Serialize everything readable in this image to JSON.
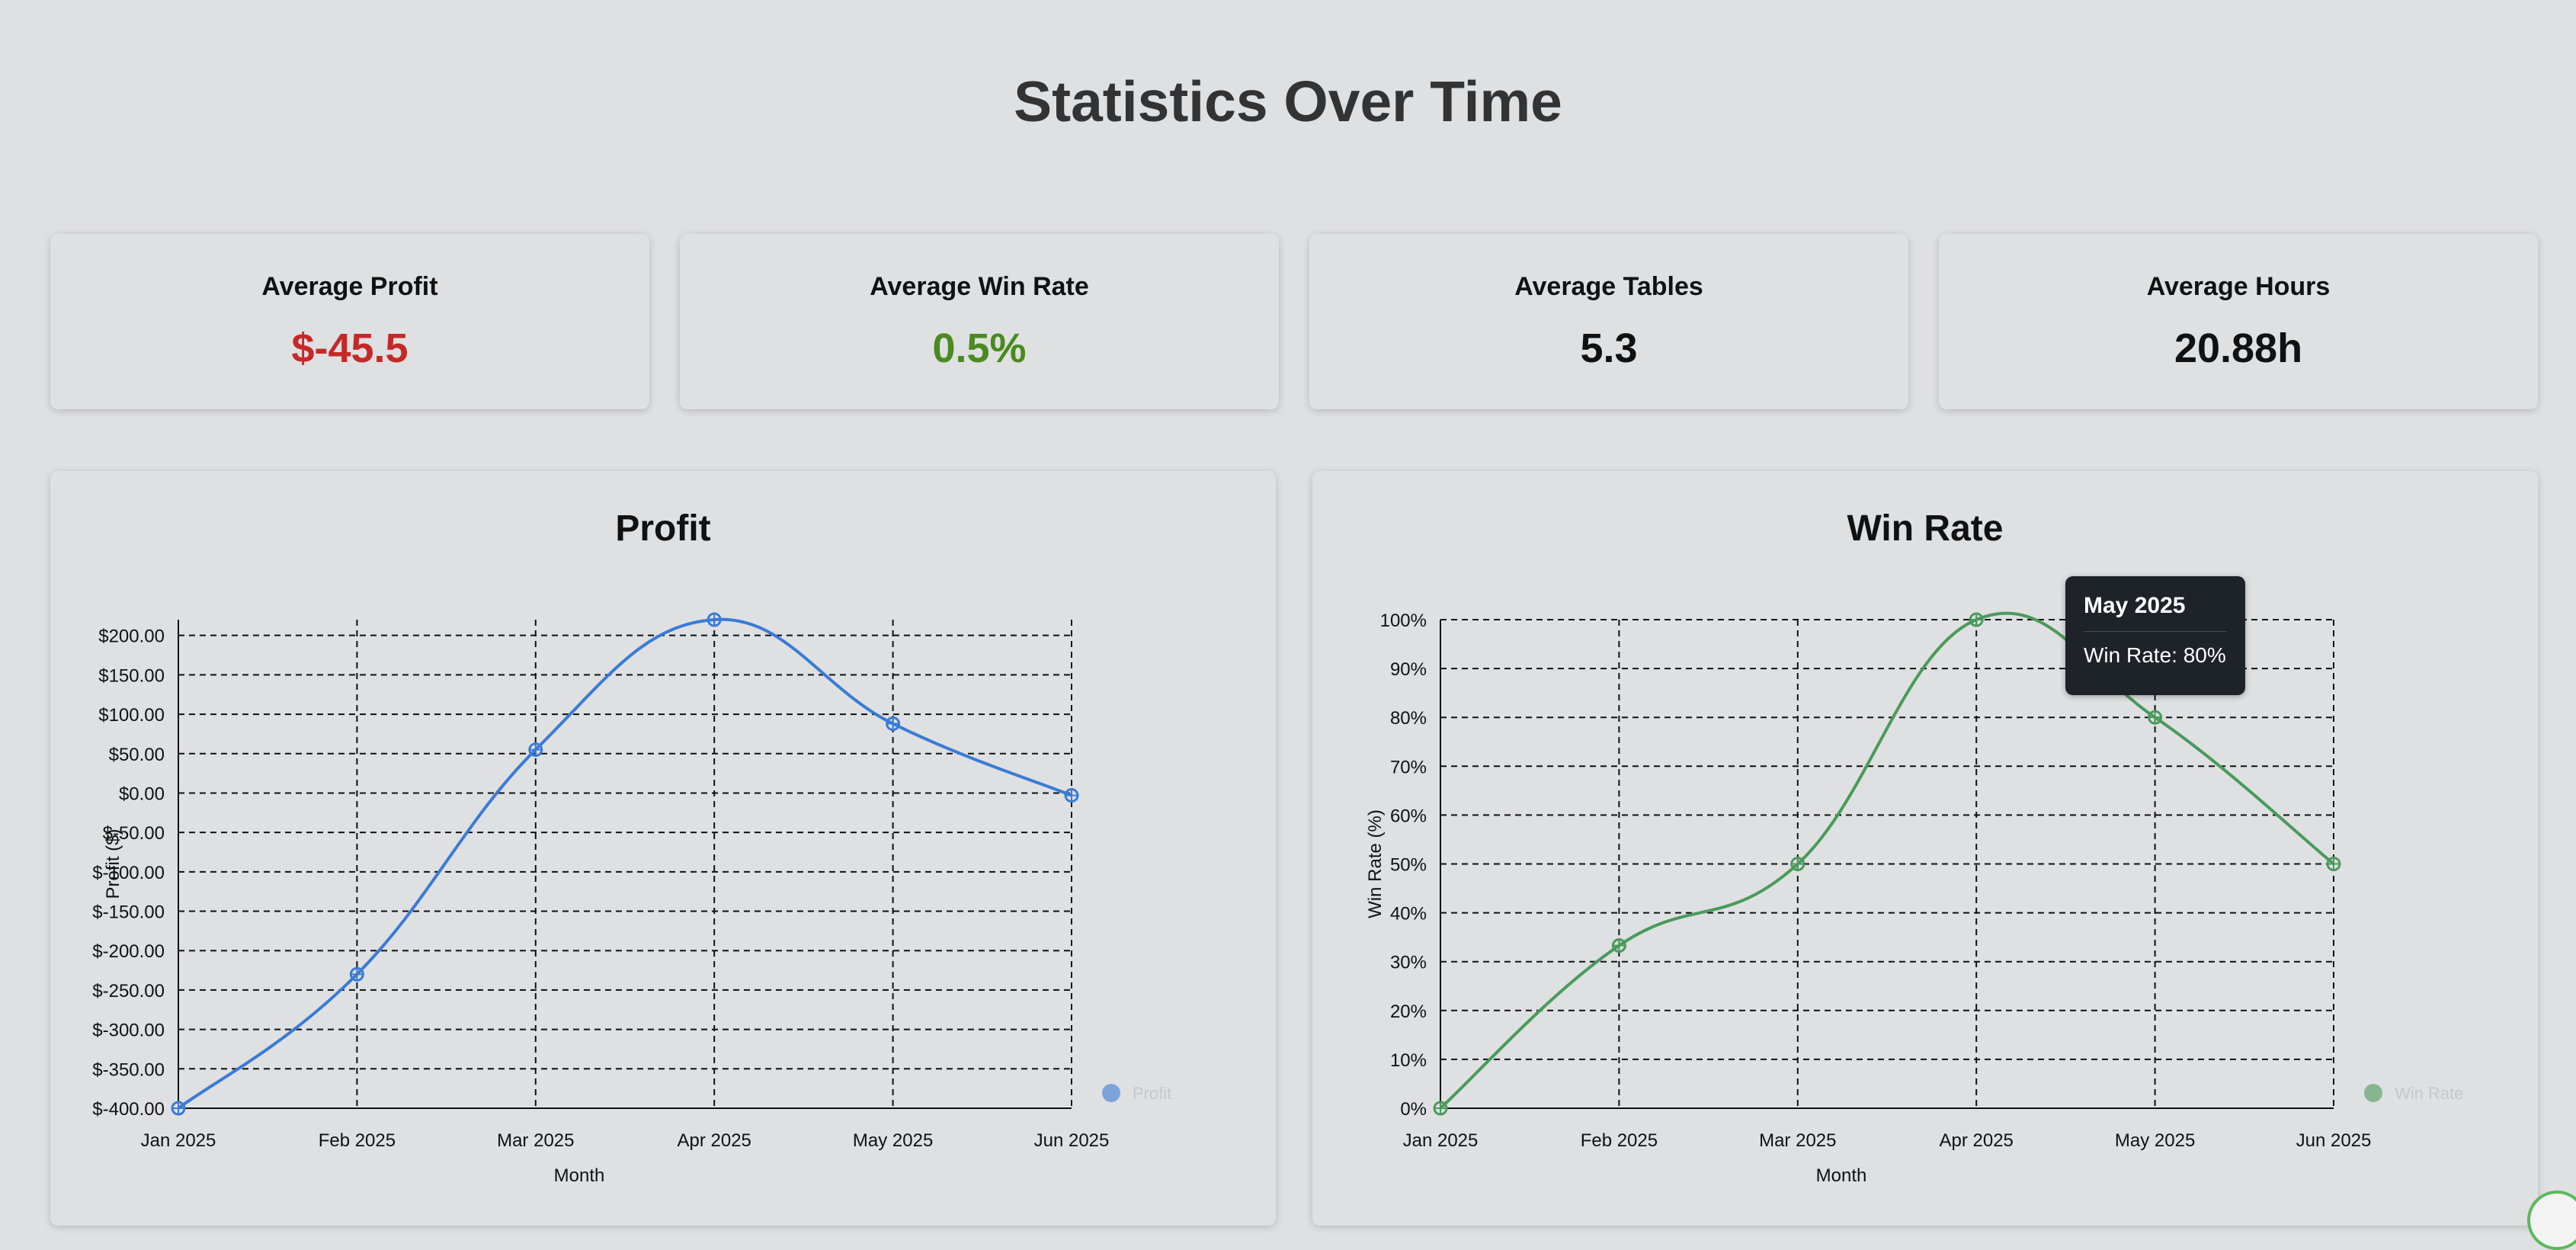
{
  "page": {
    "title": "Statistics Over Time"
  },
  "stats": [
    {
      "label": "Average Profit",
      "value": "$-45.5",
      "color": "#c62828"
    },
    {
      "label": "Average Win Rate",
      "value": "0.5%",
      "color": "#4a8a1e"
    },
    {
      "label": "Average Tables",
      "value": "5.3",
      "color": "#111111"
    },
    {
      "label": "Average Hours",
      "value": "20.88h",
      "color": "#111111"
    }
  ],
  "chart_data": [
    {
      "type": "line",
      "title": "Profit",
      "xlabel": "Month",
      "ylabel": "Profit ($)",
      "categories": [
        "Jan 2025",
        "Feb 2025",
        "Mar 2025",
        "Apr 2025",
        "May 2025",
        "Jun 2025"
      ],
      "series": [
        {
          "name": "Profit",
          "color": "#3a7bd5",
          "values": [
            -400,
            -230,
            55,
            220,
            88,
            -3
          ]
        }
      ],
      "ylim": [
        -400,
        220
      ],
      "yticks": [
        200,
        150,
        100,
        50,
        0,
        -50,
        -100,
        -150,
        -200,
        -250,
        -300,
        -350,
        -400
      ],
      "ytick_labels": [
        "$200.00",
        "$150.00",
        "$100.00",
        "$50.00",
        "$0.00",
        "$-50.00",
        "$-100.00",
        "$-150.00",
        "$-200.00",
        "$-250.00",
        "$-300.00",
        "$-350.00",
        "$-400.00"
      ],
      "grid": true,
      "legend": "right"
    },
    {
      "type": "line",
      "title": "Win Rate",
      "xlabel": "Month",
      "ylabel": "Win Rate (%)",
      "categories": [
        "Jan 2025",
        "Feb 2025",
        "Mar 2025",
        "Apr 2025",
        "May 2025",
        "Jun 2025"
      ],
      "series": [
        {
          "name": "Win Rate",
          "color": "#4a9a5c",
          "values": [
            0,
            33.3,
            50,
            100,
            80,
            50
          ]
        }
      ],
      "ylim": [
        0,
        100
      ],
      "yticks": [
        100,
        90,
        80,
        70,
        60,
        50,
        40,
        30,
        20,
        10,
        0
      ],
      "ytick_labels": [
        "100%",
        "90%",
        "80%",
        "70%",
        "60%",
        "50%",
        "40%",
        "30%",
        "20%",
        "10%",
        "0%"
      ],
      "grid": true,
      "legend": "right"
    }
  ],
  "tooltip": {
    "title": "May 2025",
    "body": "Win Rate: 80%"
  }
}
